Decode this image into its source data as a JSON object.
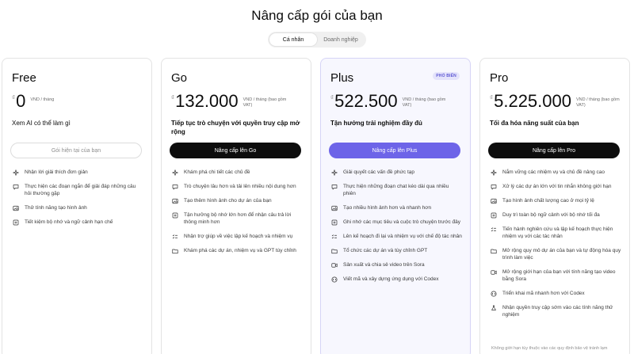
{
  "title": "Nâng cấp gói của bạn",
  "tabs": [
    {
      "label": "Cá nhân",
      "active": true
    },
    {
      "label": "Doanh nghiệp",
      "active": false
    }
  ],
  "currency_symbol": "₫",
  "plans": [
    {
      "name": "Free",
      "badge": "",
      "price": "0",
      "price_meta": "VND / tháng",
      "tagline": "Xem AI có thể làm gì",
      "cta": "Gói hiện tại của bạn",
      "features": [
        {
          "icon": "sparkle-icon",
          "text": "Nhận lời giải thích đơn giản"
        },
        {
          "icon": "chat-icon",
          "text": "Thực hiện các đoạn ngắn để giải đáp những câu hỏi thường gặp"
        },
        {
          "icon": "image-icon",
          "text": "Thử tính năng tạo hình ảnh"
        },
        {
          "icon": "memory-icon",
          "text": "Tiết kiệm bộ nhớ và ngữ cảnh hạn chế"
        }
      ]
    },
    {
      "name": "Go",
      "badge": "",
      "price": "132.000",
      "price_meta": "VND / tháng (bao gồm VAT)",
      "tagline": "Tiếp tục trò chuyện với quyền truy cập mở rộng",
      "cta": "Nâng cấp lên Go",
      "features": [
        {
          "icon": "sparkle-icon",
          "text": "Khám phá chi tiết các chủ đề"
        },
        {
          "icon": "chat-icon",
          "text": "Trò chuyện lâu hơn và tải lên nhiều nội dung hơn"
        },
        {
          "icon": "image-icon",
          "text": "Tạo thêm hình ảnh cho dự án của bạn"
        },
        {
          "icon": "memory-icon",
          "text": "Tận hưởng bộ nhớ lớn hơn để nhận câu trả lời thông minh hơn"
        },
        {
          "icon": "checklist-icon",
          "text": "Nhận trợ giúp về việc lập kế hoạch và nhiệm vụ"
        },
        {
          "icon": "folder-icon",
          "text": "Khám phá các dự án, nhiệm vụ và GPT tùy chỉnh"
        }
      ]
    },
    {
      "name": "Plus",
      "badge": "PHỔ BIẾN",
      "price": "522.500",
      "price_meta": "VND / tháng (bao gồm VAT)",
      "tagline": "Tận hưởng trải nghiệm đầy đủ",
      "cta": "Nâng cấp lên Plus",
      "features": [
        {
          "icon": "sparkle-icon",
          "text": "Giải quyết các vấn đề phức tạp"
        },
        {
          "icon": "chat-icon",
          "text": "Thực hiện những đoạn chat kéo dài qua nhiều phiên"
        },
        {
          "icon": "image-icon",
          "text": "Tạo nhiều hình ảnh hơn và nhanh hơn"
        },
        {
          "icon": "memory-icon",
          "text": "Ghi nhớ các mục tiêu và cuộc trò chuyện trước đây"
        },
        {
          "icon": "checklist-icon",
          "text": "Lên kế hoạch đi lại và nhiệm vụ với chế độ tác nhân"
        },
        {
          "icon": "folder-icon",
          "text": "Tổ chức các dự án và tùy chỉnh GPT"
        },
        {
          "icon": "video-icon",
          "text": "Sản xuất và chia sẻ video trên Sora"
        },
        {
          "icon": "code-icon",
          "text": "Viết mã và xây dựng ứng dụng với Codex"
        }
      ]
    },
    {
      "name": "Pro",
      "badge": "",
      "price": "5.225.000",
      "price_meta": "VND / tháng (bao gồm VAT)",
      "tagline": "Tối đa hóa năng suất của bạn",
      "cta": "Nâng cấp lên Pro",
      "features": [
        {
          "icon": "sparkle-icon",
          "text": "Nắm vững các nhiệm vụ và chủ đề nâng cao"
        },
        {
          "icon": "chat-icon",
          "text": "Xử lý các dự án lớn với tin nhắn không giới hạn"
        },
        {
          "icon": "image-icon",
          "text": "Tạo hình ảnh chất lượng cao ở mọi tỷ lệ"
        },
        {
          "icon": "memory-icon",
          "text": "Duy trì toàn bộ ngữ cảnh với bộ nhớ tối đa"
        },
        {
          "icon": "checklist-icon",
          "text": "Tiến hành nghiên cứu và lập kế hoạch thực hiện nhiệm vụ với các tác nhân"
        },
        {
          "icon": "folder-icon",
          "text": "Mở rộng quy mô dự án của bạn và tự động hóa quy trình làm việc"
        },
        {
          "icon": "video-icon",
          "text": "Mở rộng giới hạn của bạn với tính năng tạo video bằng Sora"
        },
        {
          "icon": "code-icon",
          "text": "Triển khai mã nhanh hơn với Codex"
        },
        {
          "icon": "flask-icon",
          "text": "Nhận quyền truy cập sớm vào các tính năng thử nghiệm"
        }
      ]
    }
  ],
  "footer_note": "Không giới hạn tùy thuộc vào các quy định bảo vệ tránh lạm",
  "colors": {
    "primary_dark": "#0d0d0d",
    "accent_purple": "#6d64e8",
    "plus_card_bg": "#f7f7fe",
    "badge_text": "#5c57d3"
  }
}
